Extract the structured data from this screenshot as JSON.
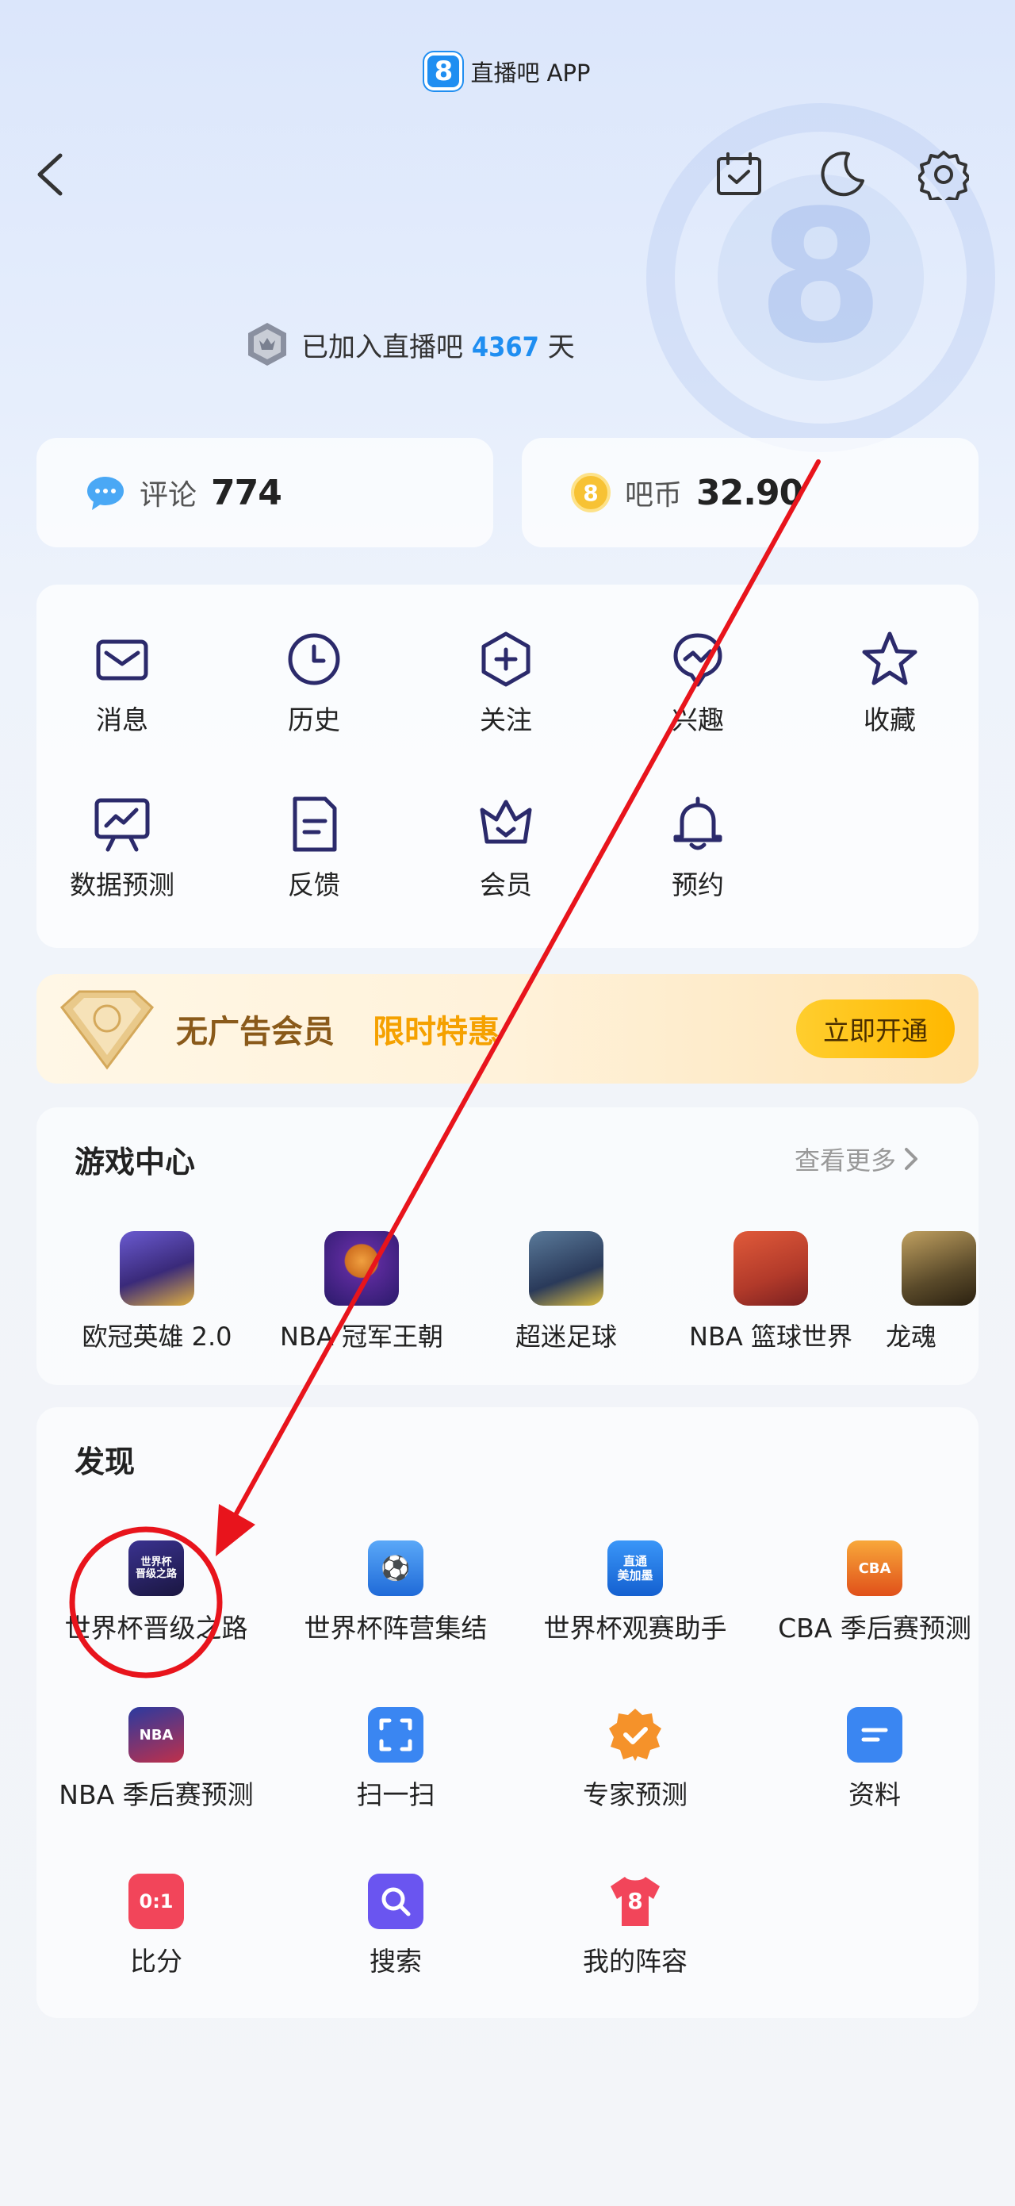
{
  "header": {
    "app_title": "直播吧 APP",
    "logo_glyph": "8"
  },
  "join": {
    "prefix": "已加入直播吧",
    "days": "4367",
    "suffix": "天"
  },
  "stats": {
    "comments": {
      "label": "评论",
      "value": "774"
    },
    "coins": {
      "label": "吧币",
      "value": "32.90",
      "icon_glyph": "8"
    }
  },
  "menu": [
    {
      "label": "消息",
      "icon": "message-icon"
    },
    {
      "label": "历史",
      "icon": "clock-icon"
    },
    {
      "label": "关注",
      "icon": "follow-plus-icon"
    },
    {
      "label": "兴趣",
      "icon": "interest-icon"
    },
    {
      "label": "收藏",
      "icon": "star-icon"
    },
    {
      "label": "数据预测",
      "icon": "chart-board-icon"
    },
    {
      "label": "反馈",
      "icon": "feedback-icon"
    },
    {
      "label": "会员",
      "icon": "crown-icon"
    },
    {
      "label": "预约",
      "icon": "bell-icon"
    }
  ],
  "vip": {
    "title": "无广告会员",
    "promo": "限时特惠",
    "button": "立即开通"
  },
  "games": {
    "title": "游戏中心",
    "more": "查看更多",
    "items": [
      {
        "label": "欧冠英雄 2.0",
        "color": "#3a2a7a"
      },
      {
        "label": "NBA 冠军王朝",
        "color": "#5a2a9a"
      },
      {
        "label": "超迷足球",
        "color": "#2a5a3a"
      },
      {
        "label": "NBA 篮球世界",
        "color": "#b23a2a"
      },
      {
        "label": "龙魂",
        "color": "#5a4a2a"
      }
    ]
  },
  "discover": {
    "title": "发现",
    "items": [
      {
        "label": "世界杯晋级之路",
        "icon": "world-cup-road-icon",
        "color": "#2a2560",
        "glyph": "世界杯\n晋级之路"
      },
      {
        "label": "世界杯阵营集结",
        "icon": "world-cup-lineup-icon",
        "color": "#3a8af0",
        "glyph": "⚽"
      },
      {
        "label": "世界杯观赛助手",
        "icon": "watch-assistant-icon",
        "color": "#1f7ae8",
        "glyph": "直通\n美加墨"
      },
      {
        "label": "CBA 季后赛预测",
        "icon": "cba-predict-icon",
        "color": "#f08a1a",
        "glyph": "CBA"
      },
      {
        "label": "NBA 季后赛预测",
        "icon": "nba-predict-icon",
        "color": "#c0304a",
        "glyph": "NBA"
      },
      {
        "label": "扫一扫",
        "icon": "scan-icon",
        "color": "#3a86f2",
        "glyph": "[ ]"
      },
      {
        "label": "专家预测",
        "icon": "expert-badge-icon",
        "color": "#f5922a",
        "glyph": "✓"
      },
      {
        "label": "资料",
        "icon": "profile-doc-icon",
        "color": "#3a86f2",
        "glyph": "≡"
      },
      {
        "label": "比分",
        "icon": "score-icon",
        "color": "#f2455a",
        "glyph": "0:1"
      },
      {
        "label": "搜索",
        "icon": "search-icon",
        "color": "#6a55f0",
        "glyph": "⌕"
      },
      {
        "label": "我的阵容",
        "icon": "jersey-icon",
        "color": "#f2455a",
        "glyph": "8"
      }
    ]
  },
  "colors": {
    "accent": "#1f8ef1",
    "icon_stroke": "#2b2a6b",
    "annotation_red": "#e8141c"
  }
}
